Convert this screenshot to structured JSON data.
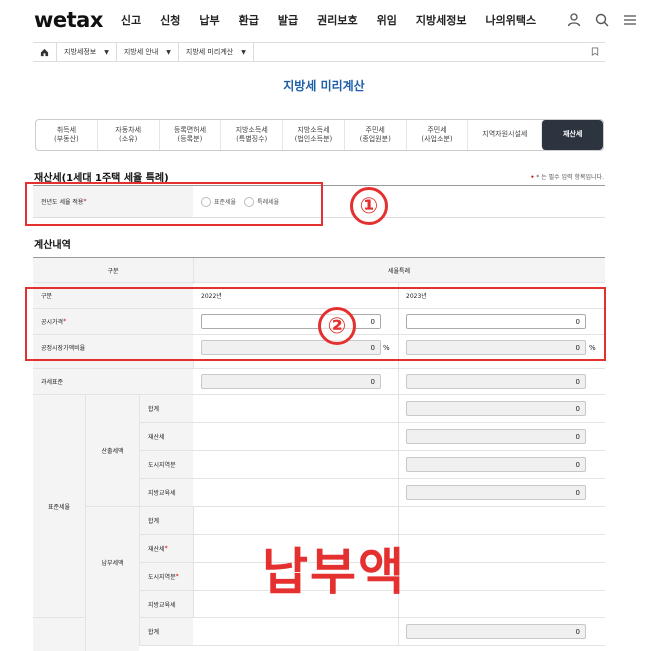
{
  "header": {
    "logo": "wetax",
    "nav": [
      "신고",
      "신청",
      "납부",
      "환급",
      "발급",
      "권리보호",
      "위임",
      "지방세정보",
      "나의위택스"
    ],
    "icons": [
      "user-icon",
      "search-icon",
      "menu-icon"
    ]
  },
  "breadcrumb": {
    "items": [
      "지방세정보",
      "지방세 안내",
      "지방세 미리계산"
    ]
  },
  "page_title": "지방세 미리계산",
  "tabs": [
    {
      "line1": "취득세",
      "line2": "(부동산)"
    },
    {
      "line1": "자동차세",
      "line2": "(소유)"
    },
    {
      "line1": "등록면허세",
      "line2": "(등록분)"
    },
    {
      "line1": "지방소득세",
      "line2": "(특별징수)"
    },
    {
      "line1": "지방소득세",
      "line2": "(법인소득분)"
    },
    {
      "line1": "주민세",
      "line2": "(종업원분)"
    },
    {
      "line1": "주민세",
      "line2": "(사업소분)"
    },
    {
      "line1": "지역자원시설세",
      "line2": ""
    },
    {
      "line1": "재산세",
      "line2": ""
    }
  ],
  "active_tab_index": 8,
  "section1": {
    "title": "재산세(1세대 1주택 세율 특례)",
    "required_note": "* 는 필수 입력 항목입니다.",
    "row_label": "전년도 세율 적용",
    "radio_options": [
      "표준세율",
      "특례세율"
    ]
  },
  "section2": {
    "title": "계산내역",
    "header_left": "구분",
    "header_right": "세율특례",
    "rows": {
      "gubun": {
        "label": "구분",
        "col1": "2022년",
        "col2": "2023년"
      },
      "price": {
        "label": "공시가격",
        "val1": "0",
        "val2": "0"
      },
      "ratio": {
        "label": "공정시장가액비율",
        "val1": "0",
        "val2": "0",
        "unit": "%"
      },
      "base": {
        "label": "과세표준",
        "val1": "0",
        "val2": "0"
      }
    },
    "group_label": "표준세율",
    "sub_calc": {
      "label": "산출세액",
      "items": [
        {
          "label": "합계",
          "value": "0"
        },
        {
          "label": "재산세",
          "value": "0"
        },
        {
          "label": "도시지역분",
          "value": "0"
        },
        {
          "label": "지방교육세",
          "value": "0"
        }
      ]
    },
    "sub_pay": {
      "label": "납부세액",
      "items": [
        {
          "label": "합계"
        },
        {
          "label": "재산세"
        },
        {
          "label": "도시지역분"
        },
        {
          "label": "지방교육세"
        }
      ]
    },
    "next_row": {
      "label": "합계",
      "value": "0"
    }
  },
  "annotations": {
    "marker1": "①",
    "marker2": "②",
    "text": "납부액",
    "color": "#e53030"
  }
}
